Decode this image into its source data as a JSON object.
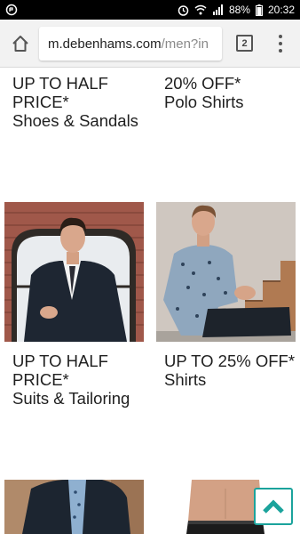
{
  "status_bar": {
    "battery": "88%",
    "time": "20:32"
  },
  "browser": {
    "url_domain": "m.debenhams.com",
    "url_path": "/men?in",
    "tab_count": "2"
  },
  "promos": [
    {
      "offer": "UP TO HALF PRICE*",
      "category": "Shoes & Sandals"
    },
    {
      "offer": "20% OFF*",
      "category": "Polo Shirts"
    },
    {
      "offer": "UP TO HALF PRICE*",
      "category": "Suits & Tailoring"
    },
    {
      "offer": "UP TO 25% OFF*",
      "category": "Shirts"
    }
  ],
  "colors": {
    "accent": "#1ba39c",
    "text": "#1f1f1f",
    "url_path": "#8a8a8a"
  },
  "icons": {
    "home": "home-icon",
    "menu": "more-vert-icon",
    "back_to_top": "chevron-up-icon"
  }
}
